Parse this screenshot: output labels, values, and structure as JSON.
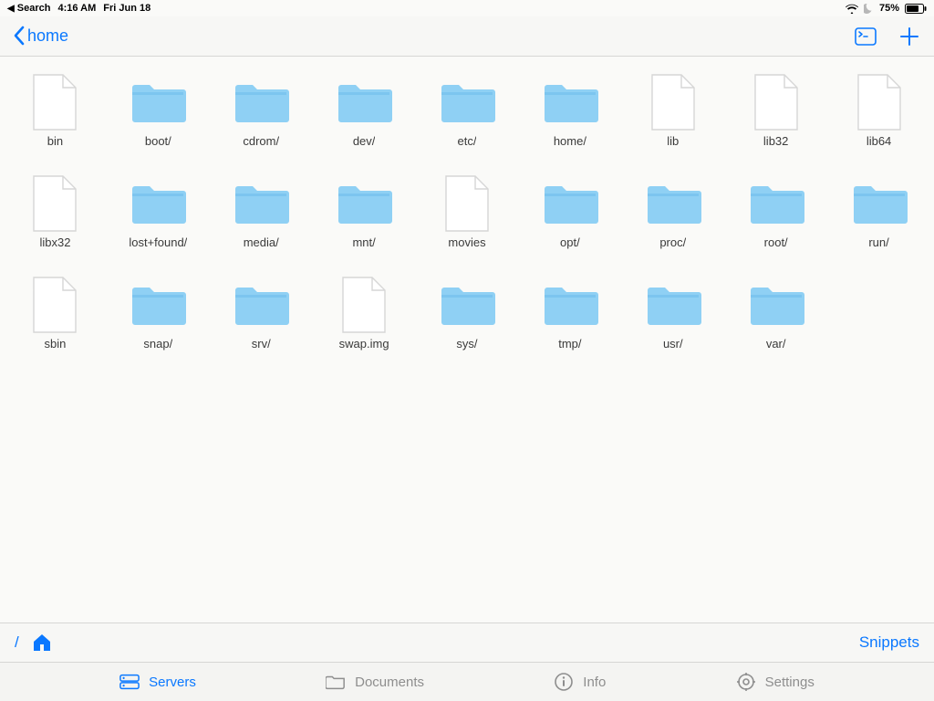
{
  "statusbar": {
    "back_app": "Search",
    "time": "4:16 AM",
    "date": "Fri Jun 18",
    "battery_pct": "75%"
  },
  "navbar": {
    "back_title": "home"
  },
  "pathbar": {
    "root_label": "/",
    "snippets_label": "Snippets"
  },
  "tabs": {
    "servers": "Servers",
    "documents": "Documents",
    "info": "Info",
    "settings": "Settings"
  },
  "items": [
    {
      "name": "bin",
      "kind": "file"
    },
    {
      "name": "boot/",
      "kind": "folder"
    },
    {
      "name": "cdrom/",
      "kind": "folder"
    },
    {
      "name": "dev/",
      "kind": "folder"
    },
    {
      "name": "etc/",
      "kind": "folder"
    },
    {
      "name": "home/",
      "kind": "folder"
    },
    {
      "name": "lib",
      "kind": "file"
    },
    {
      "name": "lib32",
      "kind": "file"
    },
    {
      "name": "lib64",
      "kind": "file"
    },
    {
      "name": "libx32",
      "kind": "file"
    },
    {
      "name": "lost+found/",
      "kind": "folder"
    },
    {
      "name": "media/",
      "kind": "folder"
    },
    {
      "name": "mnt/",
      "kind": "folder"
    },
    {
      "name": "movies",
      "kind": "file"
    },
    {
      "name": "opt/",
      "kind": "folder"
    },
    {
      "name": "proc/",
      "kind": "folder"
    },
    {
      "name": "root/",
      "kind": "folder"
    },
    {
      "name": "run/",
      "kind": "folder"
    },
    {
      "name": "sbin",
      "kind": "file"
    },
    {
      "name": "snap/",
      "kind": "folder"
    },
    {
      "name": "srv/",
      "kind": "folder"
    },
    {
      "name": "swap.img",
      "kind": "file"
    },
    {
      "name": "sys/",
      "kind": "folder"
    },
    {
      "name": "tmp/",
      "kind": "folder"
    },
    {
      "name": "usr/",
      "kind": "folder"
    },
    {
      "name": "var/",
      "kind": "folder"
    }
  ]
}
